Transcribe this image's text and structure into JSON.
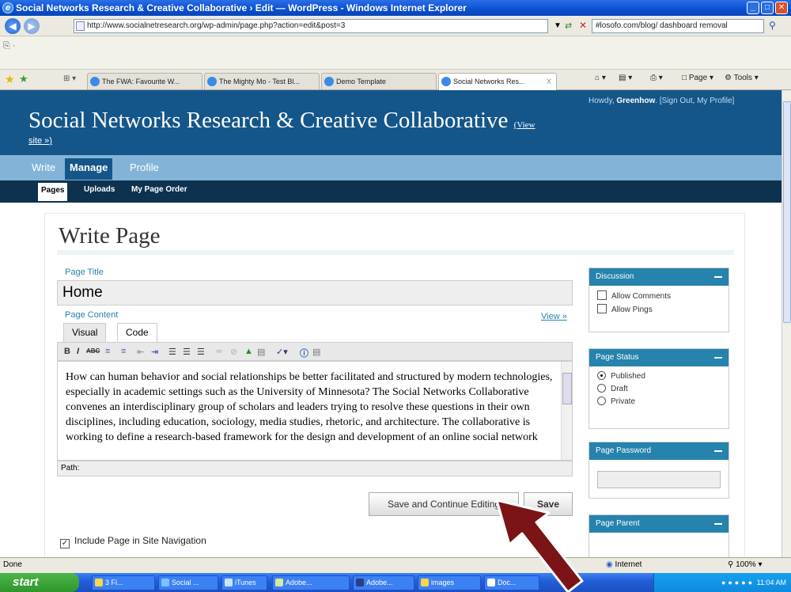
{
  "window": {
    "title": "Social Networks Research & Creative Collaborative › Edit — WordPress - Windows Internet Explorer"
  },
  "address": {
    "url": "http://www.socialnetresearch.org/wp-admin/page.php?action=edit&post=3",
    "search": "#losofo.com/blog/ dashboard removal"
  },
  "tabs": [
    "The FWA: Favourite W...",
    "The Mighty Mo - Test Bl...",
    "Demo Template",
    "Social Networks Res..."
  ],
  "tab_close": "X",
  "toolbar": {
    "page": "Page",
    "tools": "Tools"
  },
  "wp": {
    "site_title": "Social Networks Research & Creative Collaborative",
    "view_site_a": "(View",
    "view_site_b": "site »)",
    "howdy": "Howdy,",
    "user": "Greenhow",
    "account_links": "[Sign Out, My Profile]",
    "menu": [
      "Write",
      "Manage",
      "Profile"
    ],
    "submenu": [
      "Pages",
      "Uploads",
      "My Page Order"
    ],
    "page_heading": "Write Page",
    "page_title_label": "Page Title",
    "page_title_value": "Home",
    "page_content_label": "Page Content",
    "view_link": "View »",
    "editor_tabs": [
      "Visual",
      "Code"
    ],
    "editor_text": "How can human behavior and social relationships be better facilitated and structured by modern technologies, especially in academic settings such as the University of Minnesota? The Social Networks Collaborative convenes an interdisciplinary group of scholars and leaders trying to resolve these questions in their own disciplines, including education, sociology, media studies, rhetoric, and architecture. The collaborative is working to define a research-based framework for the design and development of an online social network",
    "path_label": "Path:",
    "save_continue": "Save and Continue Editing",
    "save": "Save",
    "include_nav": "Include Page in Site Navigation",
    "include_nav_checked": true,
    "discussion": {
      "title": "Discussion",
      "options": [
        "Allow Comments",
        "Allow Pings"
      ]
    },
    "status": {
      "title": "Page Status",
      "options": [
        "Published",
        "Draft",
        "Private"
      ],
      "selected": "Published"
    },
    "password": {
      "title": "Page Password"
    },
    "parent": {
      "title": "Page Parent"
    }
  },
  "statusbar": {
    "text": "Done",
    "zone": "Internet",
    "zoom": "100%"
  },
  "taskbar": {
    "start": "start",
    "tasks": [
      "3 Fi...",
      "Social ...",
      "iTunes",
      "Adobe...",
      "Adobe...",
      "images",
      "Doc..."
    ],
    "clock": "11:04 AM"
  },
  "colors": {
    "wp_header": "#14568a",
    "wp_menu": "#83b4d8",
    "wp_submenu": "#0d324f",
    "box_header": "#2583ad",
    "arrow": "#7a1416"
  }
}
